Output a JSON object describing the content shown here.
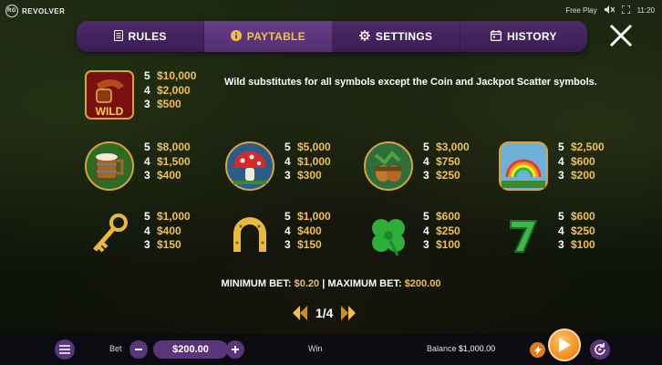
{
  "brand": {
    "logo_text": "RG",
    "name": "REVOLVER"
  },
  "status": {
    "mode": "Free Play",
    "time": "11:20"
  },
  "tabs": [
    {
      "label": "RULES",
      "icon": "document-icon"
    },
    {
      "label": "PAYTABLE",
      "icon": "info-icon"
    },
    {
      "label": "SETTINGS",
      "icon": "gear-icon"
    },
    {
      "label": "HISTORY",
      "icon": "calendar-icon"
    }
  ],
  "active_tab": "PAYTABLE",
  "wild_text": "Wild substitutes for all symbols except the Coin and Jackpot Scatter symbols.",
  "paytable": {
    "wild": {
      "symbol": "wild-pipe-icon",
      "pays": [
        [
          "5",
          "$10,000"
        ],
        [
          "4",
          "$2,000"
        ],
        [
          "3",
          "$500"
        ]
      ]
    },
    "row2": [
      {
        "symbol": "mug-icon",
        "pays": [
          [
            "5",
            "$8,000"
          ],
          [
            "4",
            "$1,500"
          ],
          [
            "3",
            "$400"
          ]
        ]
      },
      {
        "symbol": "mushroom-icon",
        "pays": [
          [
            "5",
            "$5,000"
          ],
          [
            "4",
            "$1,000"
          ],
          [
            "3",
            "$300"
          ]
        ]
      },
      {
        "symbol": "acorn-icon",
        "pays": [
          [
            "5",
            "$3,000"
          ],
          [
            "4",
            "$750"
          ],
          [
            "3",
            "$250"
          ]
        ]
      },
      {
        "symbol": "rainbow-icon",
        "pays": [
          [
            "5",
            "$2,500"
          ],
          [
            "4",
            "$600"
          ],
          [
            "3",
            "$200"
          ]
        ]
      }
    ],
    "row3": [
      {
        "symbol": "key-icon",
        "pays": [
          [
            "5",
            "$1,000"
          ],
          [
            "4",
            "$400"
          ],
          [
            "3",
            "$150"
          ]
        ]
      },
      {
        "symbol": "horseshoe-icon",
        "pays": [
          [
            "5",
            "$1,000"
          ],
          [
            "4",
            "$400"
          ],
          [
            "3",
            "$150"
          ]
        ]
      },
      {
        "symbol": "clover-icon",
        "pays": [
          [
            "5",
            "$600"
          ],
          [
            "4",
            "$250"
          ],
          [
            "3",
            "$100"
          ]
        ]
      },
      {
        "symbol": "seven-icon",
        "pays": [
          [
            "5",
            "$600"
          ],
          [
            "4",
            "$250"
          ],
          [
            "3",
            "$100"
          ]
        ]
      }
    ]
  },
  "bet_info": {
    "min_label": "MINIMUM BET:",
    "min_value": "$0.20",
    "sep": "|",
    "max_label": "MAXIMUM BET:",
    "max_value": "$200.00"
  },
  "pager": {
    "text": "1/4"
  },
  "bottom": {
    "bet_label": "Bet",
    "bet_value": "$200.00",
    "win_label": "Win",
    "balance_label": "Balance",
    "balance_value": "$1,000.00"
  },
  "colors": {
    "accent": "#f0c04a",
    "tab_bg": "#4d2a6b",
    "button": "#5a3579",
    "spin": "#f08a1a"
  }
}
